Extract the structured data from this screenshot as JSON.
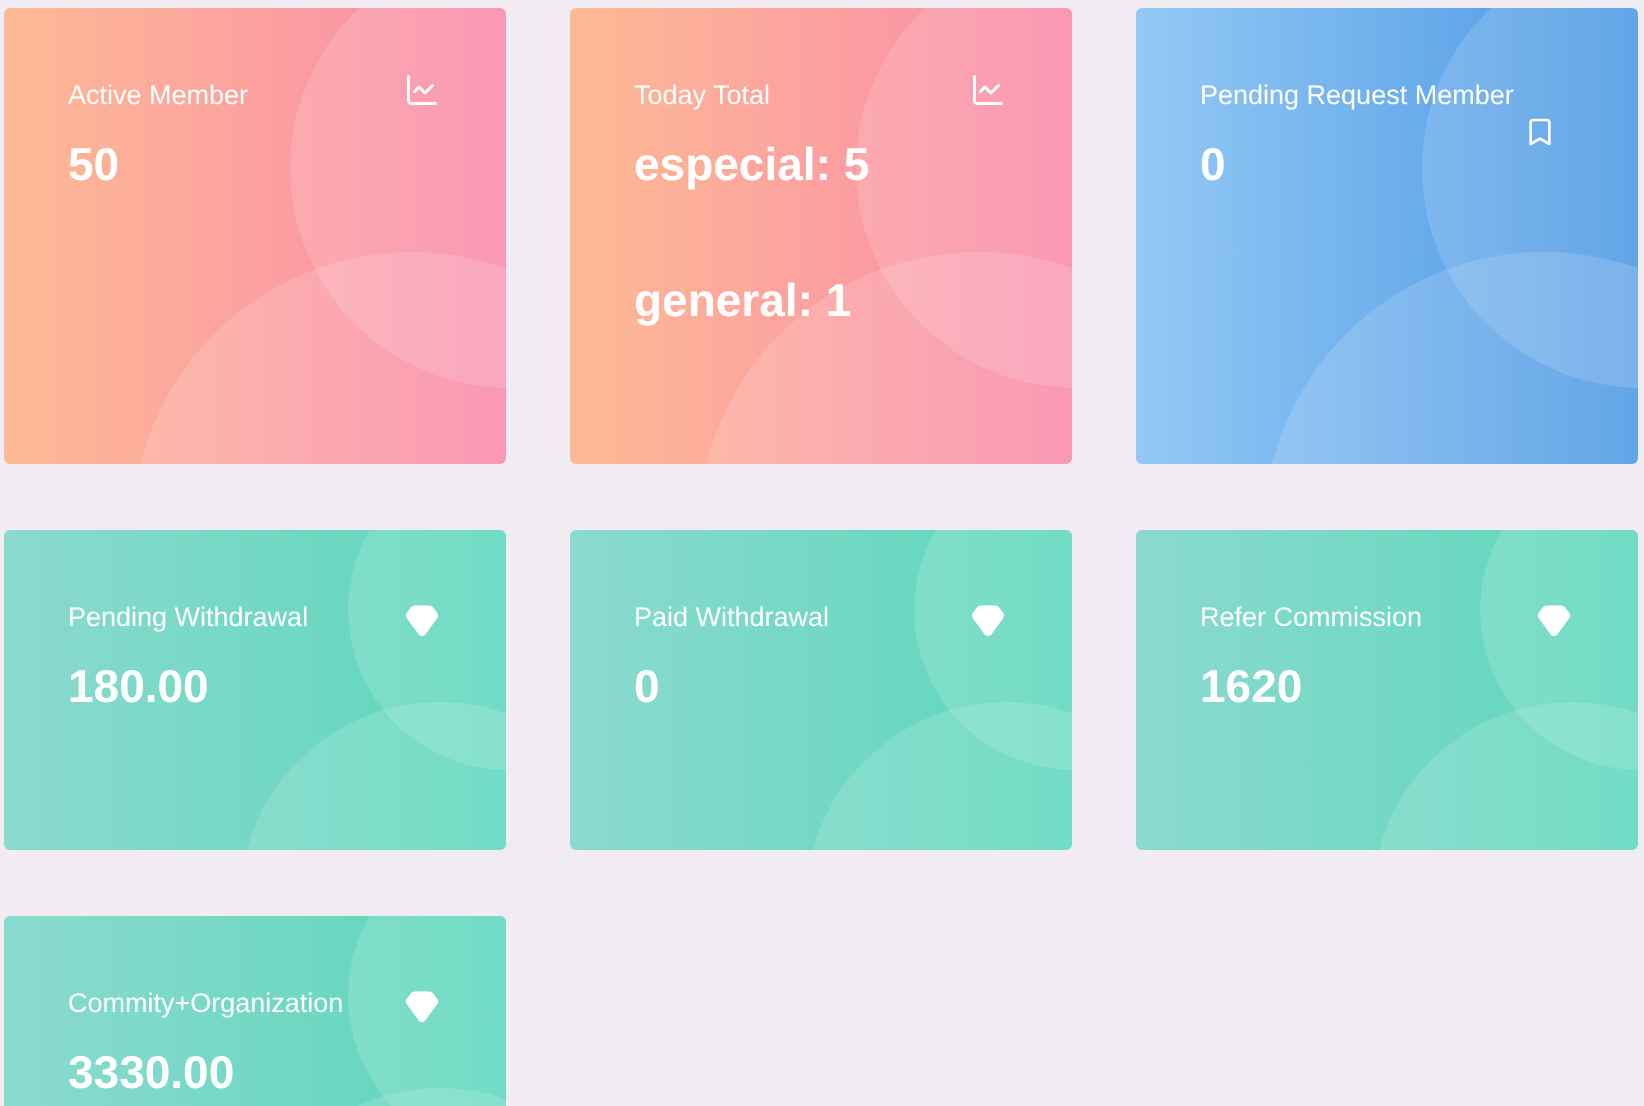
{
  "cards": [
    {
      "title": "Active Member",
      "kind": "danger",
      "values": [
        "50"
      ]
    },
    {
      "title": "Today Total",
      "kind": "danger",
      "values": [
        "especial: 5",
        "general: 1"
      ]
    },
    {
      "title": "Pending Request Member",
      "kind": "info",
      "values": [
        "0"
      ]
    },
    {
      "title": "Pending Withdrawal",
      "kind": "success",
      "values": [
        "180.00"
      ]
    },
    {
      "title": "Paid Withdrawal",
      "kind": "success",
      "values": [
        "0"
      ]
    },
    {
      "title": "Refer Commission",
      "kind": "success",
      "values": [
        "1620"
      ]
    },
    {
      "title": "Commity+Organization",
      "kind": "success",
      "values": [
        "3330.00"
      ]
    }
  ]
}
